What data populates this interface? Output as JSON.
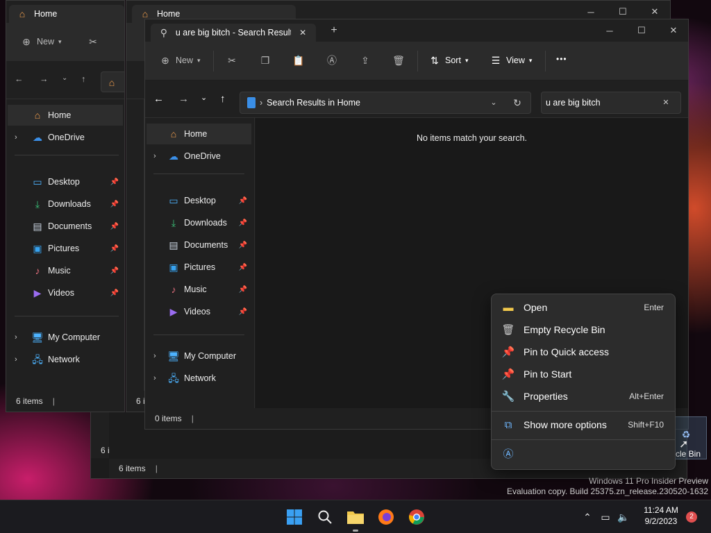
{
  "colors": {
    "accent": "#0078d4",
    "folder": "#f2c94c",
    "home": "#f6a04d",
    "onedrive": "#3a8ee6",
    "badge": "#e04f4f"
  },
  "back1": {
    "tab_title": "Home",
    "new_label": "New",
    "nav": [
      {
        "label": "Home",
        "icon": "home-icon"
      },
      {
        "label": "OneDrive",
        "icon": "cloud-icon"
      },
      {
        "label": "Desktop",
        "icon": "desktop-icon"
      },
      {
        "label": "Downloads",
        "icon": "download-icon"
      },
      {
        "label": "Documents",
        "icon": "document-icon"
      },
      {
        "label": "Pictures",
        "icon": "pictures-icon"
      },
      {
        "label": "Music",
        "icon": "music-icon"
      },
      {
        "label": "Videos",
        "icon": "video-icon"
      },
      {
        "label": "My Computer",
        "icon": "computer-icon"
      },
      {
        "label": "Network",
        "icon": "network-icon"
      }
    ],
    "status": "6 items"
  },
  "back2": {
    "tab_title": "Home",
    "status_partial": "6 i",
    "status_partial2": "6 i"
  },
  "back3": {
    "status": "6 items"
  },
  "front": {
    "tab_title": "u are big bitch - Search Result",
    "toolbar": {
      "new": "New",
      "sort": "Sort",
      "view": "View",
      "more": "•••"
    },
    "address": {
      "prefix": "›",
      "text": "Search Results in Home"
    },
    "search": {
      "value": "u are big bitch",
      "clear": "✕"
    },
    "empty_message": "No items match your search.",
    "nav": [
      {
        "label": "Home"
      },
      {
        "label": "OneDrive"
      },
      {
        "label": "Desktop"
      },
      {
        "label": "Downloads"
      },
      {
        "label": "Documents"
      },
      {
        "label": "Pictures"
      },
      {
        "label": "Music"
      },
      {
        "label": "Videos"
      },
      {
        "label": "My Computer"
      },
      {
        "label": "Network"
      }
    ],
    "status": "0 items"
  },
  "context_menu": {
    "items": [
      {
        "label": "Open",
        "shortcut": "Enter",
        "icon": "folder-icon"
      },
      {
        "label": "Empty Recycle Bin",
        "shortcut": "",
        "icon": "trash-icon"
      },
      {
        "label": "Pin to Quick access",
        "shortcut": "",
        "icon": "pin-icon"
      },
      {
        "label": "Pin to Start",
        "shortcut": "",
        "icon": "pin-icon"
      },
      {
        "label": "Properties",
        "shortcut": "Alt+Enter",
        "icon": "wrench-icon"
      },
      {
        "label": "Show more options",
        "shortcut": "Shift+F10",
        "icon": "more-options-icon"
      }
    ]
  },
  "desktop": {
    "recycle_label": "cle Bin",
    "watermark1": "Windows 11 Pro Insider Preview",
    "watermark2": "Evaluation copy. Build 25375.zn_release.230520-1632"
  },
  "taskbar": {
    "time": "11:24 AM",
    "date": "9/2/2023",
    "badge": "2"
  }
}
